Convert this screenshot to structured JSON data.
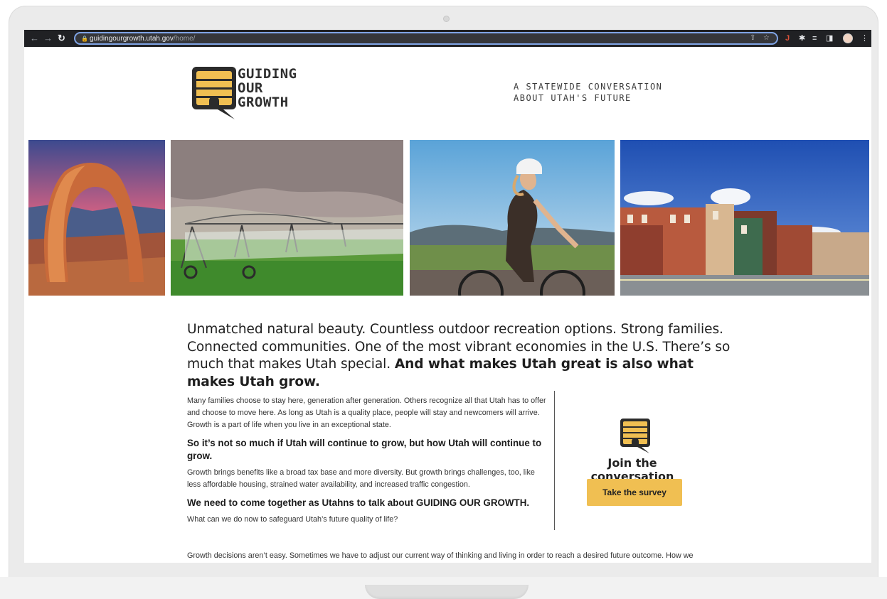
{
  "browser": {
    "url_host": "guidingourgrowth.utah.gov",
    "url_path": "/home/",
    "back_icon": "arrow-left",
    "forward_icon": "arrow-right",
    "reload_icon": "reload"
  },
  "site": {
    "logo_lines": [
      "GUIDING",
      "OUR",
      "GROWTH"
    ],
    "tagline_lines": [
      "A STATEWIDE CONVERSATION",
      "ABOUT UTAH'S FUTURE"
    ]
  },
  "photos": [
    "delicate-arch",
    "center-pivot-irrigation",
    "cyclist",
    "main-street"
  ],
  "intro": {
    "text": "Unmatched natural beauty. Countless outdoor recreation options. Strong families. Connected communities. One of the most vibrant economies in the U.S. There’s so much that makes Utah special. ",
    "emphasis": "And what makes Utah great is also what makes Utah grow."
  },
  "body": {
    "p1": "Many families choose to stay here, generation after generation. Others recognize all that Utah has to offer and choose to move here. As long as Utah is a quality place, people will stay and newcomers will arrive. Growth is a part of life when you live in an exceptional state.",
    "b1": "So it’s not so much if Utah will continue to grow, but how Utah will continue to grow.",
    "p2": "Growth brings benefits like a broad tax base and more diversity. But growth brings challenges, too, like less affordable housing, strained water availability, and increased traffic congestion.",
    "b2": "We need to come together as Utahns to talk about GUIDING OUR GROWTH.",
    "p3": "What can we do now to safeguard Utah’s future quality of life?",
    "p4": "Growth decisions aren’t easy. Sometimes we have to adjust our current way of thinking and living in order to reach a desired future outcome. How we"
  },
  "cta": {
    "title": "Join the conversation",
    "button": "Take the survey"
  },
  "colors": {
    "brand_yellow": "#f0bf52",
    "logo_dark": "#2b2b2b",
    "browser_bar": "#202124"
  }
}
